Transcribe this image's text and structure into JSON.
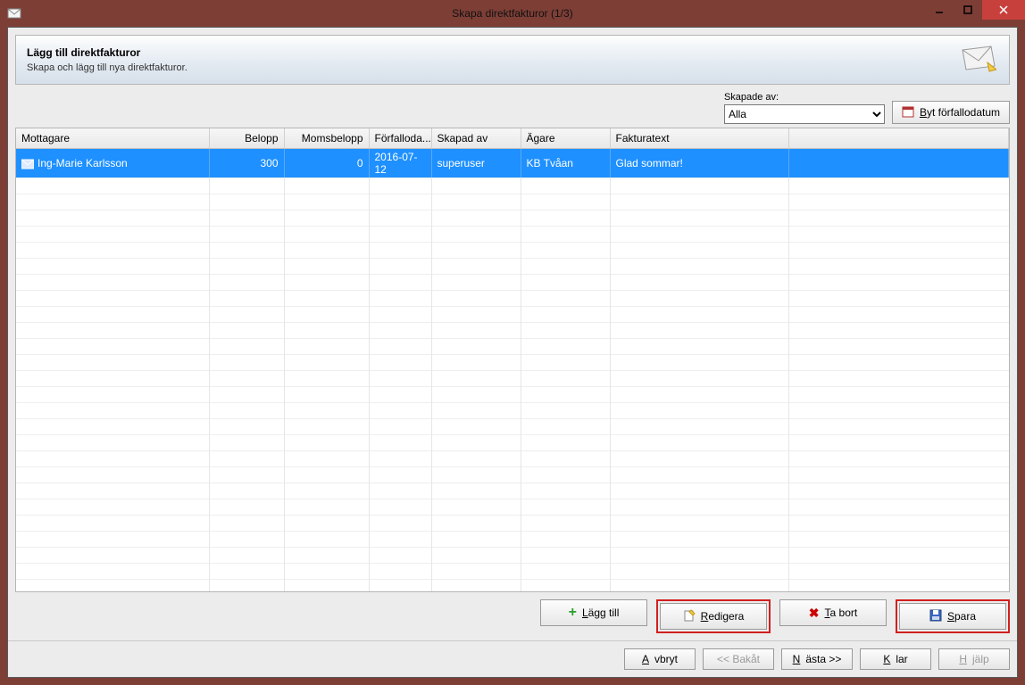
{
  "window": {
    "title": "Skapa direktfakturor (1/3)"
  },
  "header": {
    "title": "Lägg till direktfakturor",
    "subtitle": "Skapa och lägg till nya direktfakturor."
  },
  "filter": {
    "created_by_label": "Skapade av:",
    "created_by_value": "Alla",
    "change_due_date_label": "Byt förfallodatum"
  },
  "table": {
    "columns": {
      "recipient": "Mottagare",
      "amount": "Belopp",
      "vat": "Momsbelopp",
      "due": "Förfalloda...",
      "created_by": "Skapad av",
      "owner": "Ägare",
      "invoice_text": "Fakturatext"
    },
    "rows": [
      {
        "recipient": "Ing-Marie Karlsson",
        "amount": "300",
        "vat": "0",
        "due": "2016-07-12",
        "created_by": "superuser",
        "owner": "KB Tvåan",
        "invoice_text": "Glad sommar!"
      }
    ]
  },
  "actions": {
    "add": "Lägg till",
    "edit": "Redigera",
    "delete": "Ta bort",
    "save": "Spara"
  },
  "wizard": {
    "cancel": "Avbryt",
    "back": "<< Bakåt",
    "next": "Nästa >>",
    "finish": "Klar",
    "help": "Hjälp"
  }
}
